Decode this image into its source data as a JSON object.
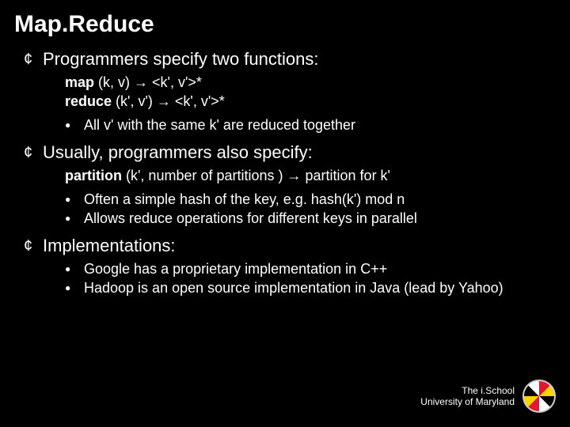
{
  "title": "Map.Reduce",
  "bullets": [
    {
      "text": "Programmers specify two functions:",
      "code": [
        {
          "kw": "map",
          "rest": " (k, v) → <k', v'>*"
        },
        {
          "kw": "reduce",
          "rest": " (k', v') → <k', v'>*"
        }
      ],
      "subs": [
        "All v' with the same k' are reduced together"
      ]
    },
    {
      "text": "Usually, programmers also specify:",
      "code": [
        {
          "kw": "partition",
          "rest": " (k', number of partitions ) → partition for k'"
        }
      ],
      "subs": [
        "Often a simple hash of the key, e.g. hash(k') mod n",
        "Allows reduce operations for different keys in parallel"
      ]
    },
    {
      "text": "Implementations:",
      "code": [],
      "subs": [
        "Google has a proprietary implementation in C++",
        "Hadoop is an open source implementation in Java (lead by Yahoo)"
      ]
    }
  ],
  "footer": {
    "line1": "The i.School",
    "line2": "University of Maryland"
  },
  "glyphs": {
    "main_bullet": "¢",
    "sub_bullet": "●"
  }
}
